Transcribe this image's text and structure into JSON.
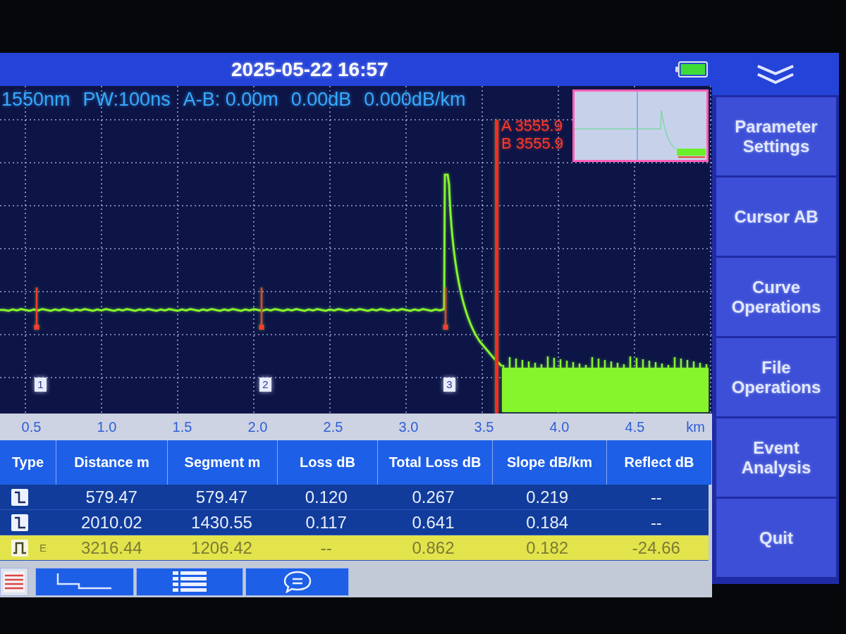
{
  "status_bar": {
    "datetime": "2025-05-22 16:57"
  },
  "trace_info": {
    "wavelength": "1550nm",
    "pulse_width": "PW:100ns",
    "ab_distance": "A-B: 0.00m",
    "ab_loss": "0.00dB",
    "ab_slope": "0.000dB/km"
  },
  "trace_view": {
    "cursors": [
      {
        "label": "A 3555.9"
      },
      {
        "label": "B 3555.9"
      }
    ],
    "event_markers": [
      {
        "label": "1"
      },
      {
        "label": "2"
      },
      {
        "label": "3"
      }
    ],
    "x_axis": {
      "ticks": [
        "0.5",
        "1.0",
        "1.5",
        "2.0",
        "2.5",
        "3.0",
        "3.5",
        "4.0",
        "4.5"
      ],
      "unit": "km"
    }
  },
  "event_table": {
    "columns": [
      "Type",
      "Distance m",
      "Segment m",
      "Loss dB",
      "Total Loss dB",
      "Slope dB/km",
      "Reflect dB"
    ],
    "rows": [
      {
        "kind": "non_reflective",
        "selected": false,
        "distance": "579.47",
        "segment": "579.47",
        "loss": "0.120",
        "total_loss": "0.267",
        "slope": "0.219",
        "reflect": "--"
      },
      {
        "kind": "non_reflective",
        "selected": false,
        "distance": "2010.02",
        "segment": "1430.55",
        "loss": "0.117",
        "total_loss": "0.641",
        "slope": "0.184",
        "reflect": "--"
      },
      {
        "kind": "reflective",
        "selected": true,
        "end_mark": "E",
        "distance": "3216.44",
        "segment": "1206.42",
        "loss": "--",
        "total_loss": "0.862",
        "slope": "0.182",
        "reflect": "-24.66"
      }
    ]
  },
  "view_tabs": [
    {
      "kind": "table",
      "selected": true
    },
    {
      "kind": "trace",
      "selected": false
    },
    {
      "kind": "list",
      "selected": false
    },
    {
      "kind": "comment",
      "selected": false
    }
  ],
  "side_menu": {
    "items": [
      "Parameter Settings",
      "Cursor AB",
      "Curve Operations",
      "File Operations",
      "Event Analysis",
      "Quit"
    ]
  }
}
